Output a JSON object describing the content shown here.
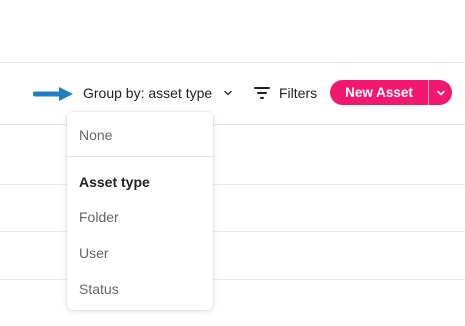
{
  "toolbar": {
    "group_by_label": "Group by: asset type",
    "filters_label": "Filters",
    "new_asset_label": "New Asset"
  },
  "group_by_menu": {
    "items": [
      {
        "label": "None",
        "selected": false
      },
      {
        "label": "Asset type",
        "selected": true
      },
      {
        "label": "Folder",
        "selected": false
      },
      {
        "label": "User",
        "selected": false
      },
      {
        "label": "Status",
        "selected": false
      }
    ]
  },
  "colors": {
    "accent": "#f2186e",
    "pointer_arrow": "#1e7fc4"
  },
  "icons": {
    "pointer": "arrow-right-icon",
    "group_by_caret": "chevron-down-icon",
    "filters": "filter-icon",
    "new_asset_caret": "chevron-down-icon"
  }
}
